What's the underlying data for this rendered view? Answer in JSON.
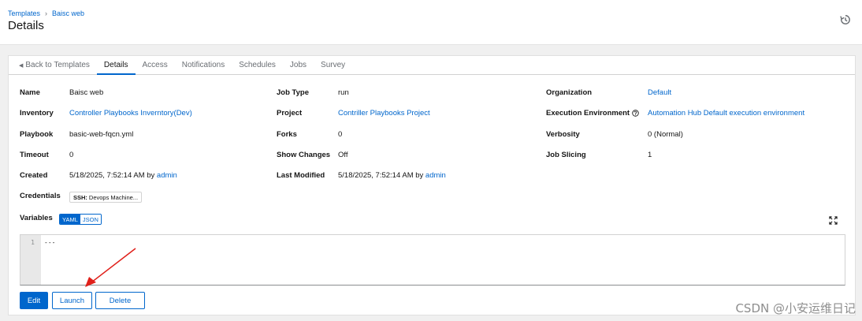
{
  "breadcrumb": {
    "parent": "Templates",
    "current": "Baisc web"
  },
  "page_title": "Details",
  "tabs": {
    "back": "Back to Templates",
    "items": [
      "Details",
      "Access",
      "Notifications",
      "Schedules",
      "Jobs",
      "Survey"
    ],
    "active": "Details"
  },
  "details": {
    "name": {
      "label": "Name",
      "value": "Baisc web"
    },
    "job_type": {
      "label": "Job Type",
      "value": "run"
    },
    "organization": {
      "label": "Organization",
      "value": "Default"
    },
    "inventory": {
      "label": "Inventory",
      "value": "Controller Playbooks Inverntory(Dev)"
    },
    "project": {
      "label": "Project",
      "value": "Contriller Playbooks Project"
    },
    "execution_environment": {
      "label": "Execution Environment",
      "value": "Automation Hub Default execution environment"
    },
    "playbook": {
      "label": "Playbook",
      "value": "basic-web-fqcn.yml"
    },
    "forks": {
      "label": "Forks",
      "value": "0"
    },
    "verbosity": {
      "label": "Verbosity",
      "value": "0 (Normal)"
    },
    "timeout": {
      "label": "Timeout",
      "value": "0"
    },
    "show_changes": {
      "label": "Show Changes",
      "value": "Off"
    },
    "job_slicing": {
      "label": "Job Slicing",
      "value": "1"
    },
    "created": {
      "label": "Created",
      "value": "5/18/2025, 7:52:14 AM by",
      "user": "admin"
    },
    "last_modified": {
      "label": "Last Modified",
      "value": "5/18/2025, 7:52:14 AM by",
      "user": "admin"
    },
    "credentials": {
      "label": "Credentials",
      "chip_type": "SSH:",
      "chip_value": "Devops Machine..."
    }
  },
  "variables": {
    "label": "Variables",
    "modes": [
      "YAML",
      "JSON"
    ],
    "active_mode": "YAML",
    "line_number": "1",
    "content": "---"
  },
  "actions": {
    "edit": "Edit",
    "launch": "Launch",
    "delete": "Delete"
  },
  "colors": {
    "accent": "#0066cc",
    "annotation_arrow": "#e0201a"
  },
  "watermark": "CSDN @小安运维日记"
}
